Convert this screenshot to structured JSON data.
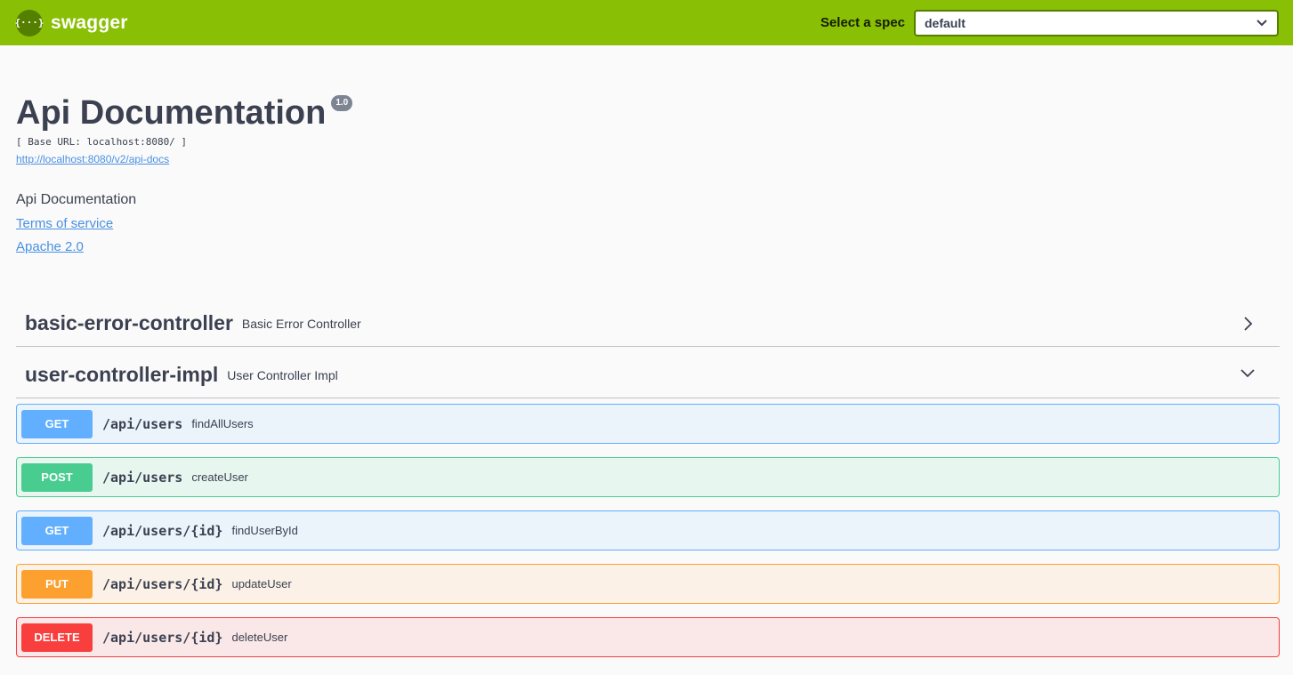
{
  "topbar": {
    "brand": "swagger",
    "logo_text": "{···}",
    "spec_label": "Select a spec",
    "spec_value": "default"
  },
  "info": {
    "title": "Api Documentation",
    "version": "1.0",
    "base_url": "[ Base URL: localhost:8080/ ]",
    "docs_link": "http://localhost:8080/v2/api-docs",
    "description": "Api Documentation",
    "terms": "Terms of service",
    "license": "Apache 2.0"
  },
  "tags": [
    {
      "name": "basic-error-controller",
      "description": "Basic Error Controller",
      "state": "collapsed"
    },
    {
      "name": "user-controller-impl",
      "description": "User Controller Impl",
      "state": "expanded"
    }
  ],
  "operations": [
    {
      "method": "GET",
      "path": "/api/users",
      "summary": "findAllUsers"
    },
    {
      "method": "POST",
      "path": "/api/users",
      "summary": "createUser"
    },
    {
      "method": "GET",
      "path": "/api/users/{id}",
      "summary": "findUserById"
    },
    {
      "method": "PUT",
      "path": "/api/users/{id}",
      "summary": "updateUser"
    },
    {
      "method": "DELETE",
      "path": "/api/users/{id}",
      "summary": "deleteUser"
    }
  ],
  "colors": {
    "topbar": "#89bf04",
    "get": "#61affe",
    "post": "#49cc90",
    "put": "#fca130",
    "delete": "#f93e3e",
    "link": "#4990e2"
  }
}
